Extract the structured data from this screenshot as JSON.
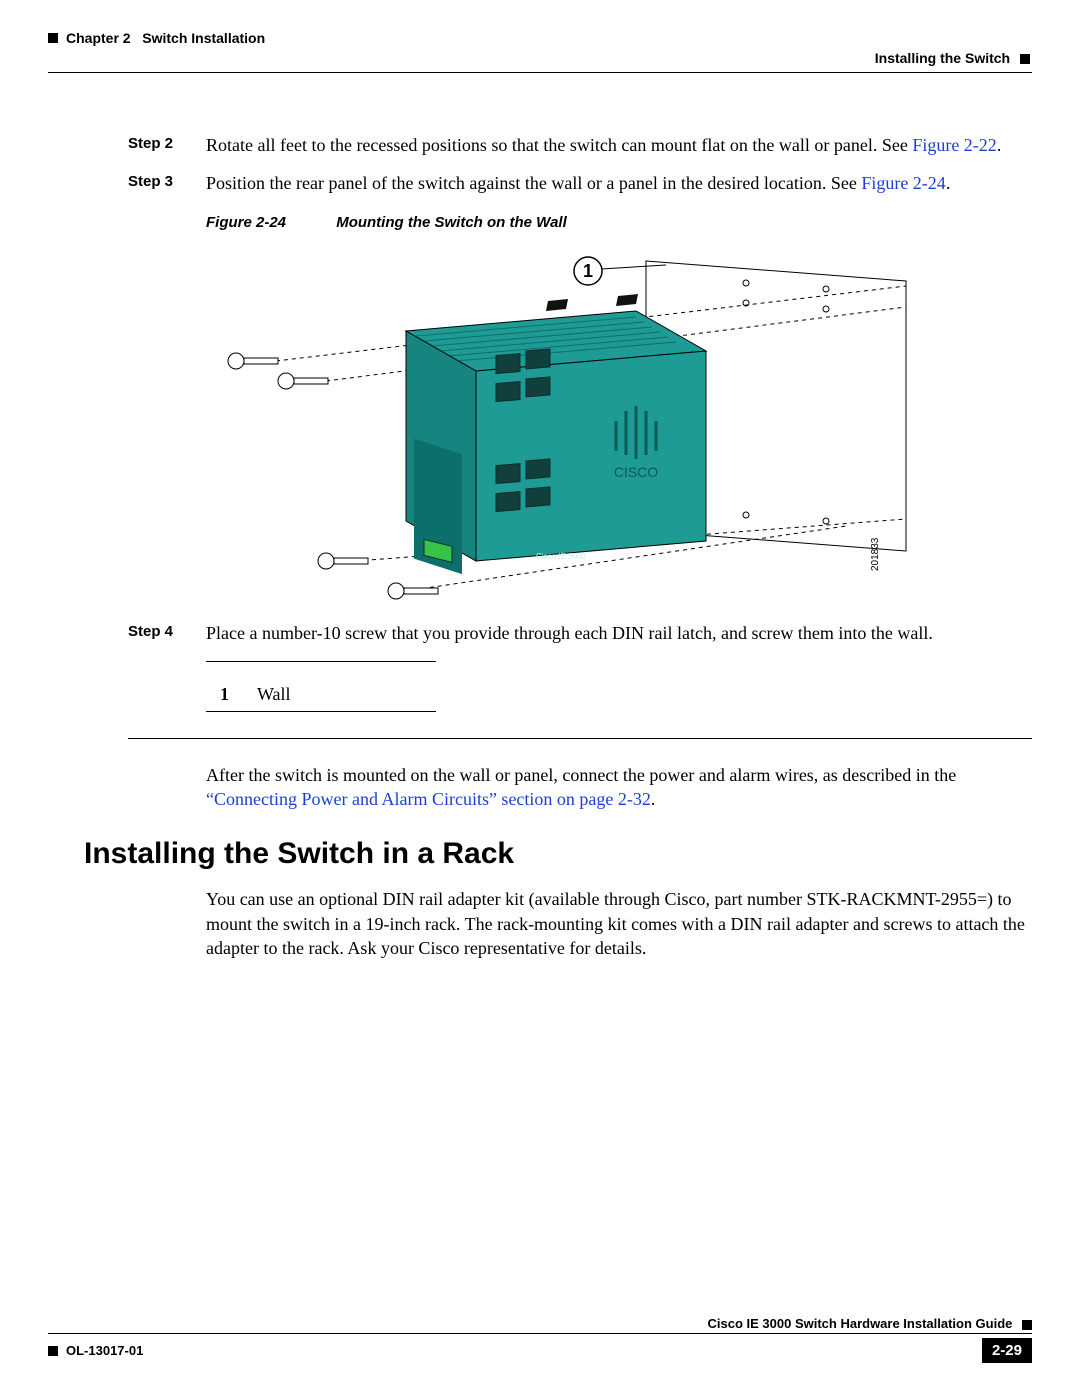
{
  "header": {
    "chapter": "Chapter 2",
    "chapter_title": "Switch Installation",
    "section": "Installing the Switch"
  },
  "steps": {
    "s2_label": "Step 2",
    "s2_text_a": "Rotate all feet to the recessed positions so that the switch can mount flat on the wall or panel. See ",
    "s2_link": "Figure 2-22",
    "s2_text_b": ".",
    "s3_label": "Step 3",
    "s3_text_a": "Position the rear panel of the switch against the wall or a panel in the desired location. See ",
    "s3_link": "Figure 2-24",
    "s3_text_b": ".",
    "s4_label": "Step 4",
    "s4_text": "Place a number-10 screw that you provide through each DIN rail latch, and screw them into the wall."
  },
  "figure": {
    "num": "Figure 2-24",
    "title": "Mounting the Switch on the Wall",
    "callout": "1",
    "device_label": "Cisco IE 3000",
    "side_code": "201833"
  },
  "legend": {
    "k1": "1",
    "v1": "Wall"
  },
  "after_para_a": "After the switch is mounted on the wall or panel, connect the power and alarm wires, as described in the ",
  "after_para_link": "“Connecting Power and Alarm Circuits” section on page 2-32",
  "after_para_b": ".",
  "section_heading": "Installing the Switch in a Rack",
  "rack_para": "You can use an optional DIN rail adapter kit (available through Cisco, part number STK-RACKMNT-2955=) to mount the switch in a 19-inch rack. The rack-mounting kit comes with a DIN rail adapter and screws to attach the adapter to the rack. Ask your Cisco representative for details.",
  "footer": {
    "guide": "Cisco IE 3000 Switch Hardware Installation Guide",
    "ol": "OL-13017-01",
    "page": "2-29"
  }
}
